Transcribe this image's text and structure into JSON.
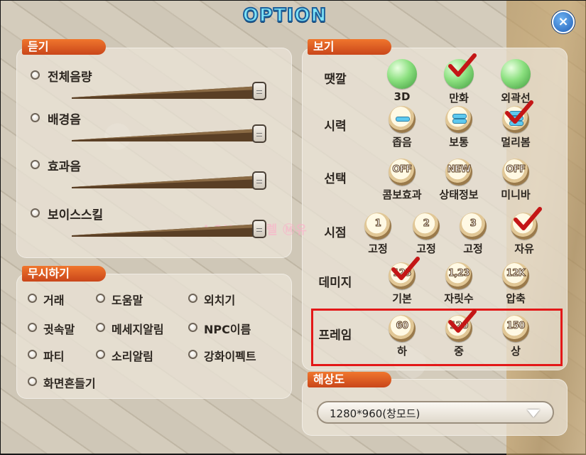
{
  "window": {
    "title": "OPTION",
    "close_label": "×"
  },
  "listen": {
    "header": "듣기",
    "items": [
      {
        "label": "전체음량",
        "level": 1.0
      },
      {
        "label": "배경음",
        "level": 1.0
      },
      {
        "label": "효과음",
        "level": 1.0
      },
      {
        "label": "보이스스킬",
        "level": 1.0
      }
    ]
  },
  "ignore": {
    "header": "무시하기",
    "items": [
      "거래",
      "도움말",
      "외치기",
      "귓속말",
      "메세지알림",
      "NPC이름",
      "파티",
      "소리알림",
      "강화이펙트",
      "화면흔들기"
    ]
  },
  "view": {
    "header": "보기",
    "rows": [
      {
        "label": "땟깔",
        "options": [
          {
            "icon": "green-ball-icon",
            "text": "",
            "caption": "3D",
            "checked": false
          },
          {
            "icon": "green-ball-icon",
            "text": "",
            "caption": "만화",
            "checked": true
          },
          {
            "icon": "green-ball-icon",
            "text": "",
            "caption": "외곽선",
            "checked": false
          }
        ]
      },
      {
        "label": "시력",
        "options": [
          {
            "icon": "one-bar-icon",
            "text": "",
            "caption": "좁음",
            "checked": false
          },
          {
            "icon": "two-bar-icon",
            "text": "",
            "caption": "보통",
            "checked": false
          },
          {
            "icon": "three-bar-icon",
            "text": "",
            "caption": "멀리봄",
            "checked": true
          }
        ]
      },
      {
        "label": "선택",
        "options": [
          {
            "icon": "coin-icon",
            "text": "OFF",
            "caption": "콤보효과",
            "checked": false
          },
          {
            "icon": "coin-icon",
            "text": "NEW",
            "caption": "상태정보",
            "checked": false
          },
          {
            "icon": "coin-icon",
            "text": "OFF",
            "caption": "미니바",
            "checked": false
          }
        ]
      },
      {
        "label": "시점",
        "options": [
          {
            "icon": "coin-icon",
            "text": "1",
            "caption": "고정",
            "checked": false
          },
          {
            "icon": "coin-icon",
            "text": "2",
            "caption": "고정",
            "checked": false
          },
          {
            "icon": "coin-icon",
            "text": "3",
            "caption": "고정",
            "checked": false
          },
          {
            "icon": "coin-icon",
            "text": "",
            "caption": "자유",
            "checked": true
          }
        ]
      },
      {
        "label": "데미지",
        "options": [
          {
            "icon": "coin-icon",
            "text": "123",
            "caption": "기본",
            "checked": true
          },
          {
            "icon": "coin-icon",
            "text": "1,23",
            "caption": "자릿수",
            "checked": false
          },
          {
            "icon": "coin-icon",
            "text": "12K",
            "caption": "압축",
            "checked": false
          }
        ]
      },
      {
        "label": "프레임",
        "options": [
          {
            "icon": "coin-icon",
            "text": "60",
            "caption": "하",
            "checked": false
          },
          {
            "icon": "coin-icon",
            "text": "120",
            "caption": "중",
            "checked": true
          },
          {
            "icon": "coin-icon",
            "text": "150",
            "caption": "상",
            "checked": false
          }
        ]
      }
    ]
  },
  "resolution": {
    "header": "해상도",
    "value": "1280*960(창모드)"
  },
  "watermark": "I 2U ~ 유렐 Ⓜ유"
}
